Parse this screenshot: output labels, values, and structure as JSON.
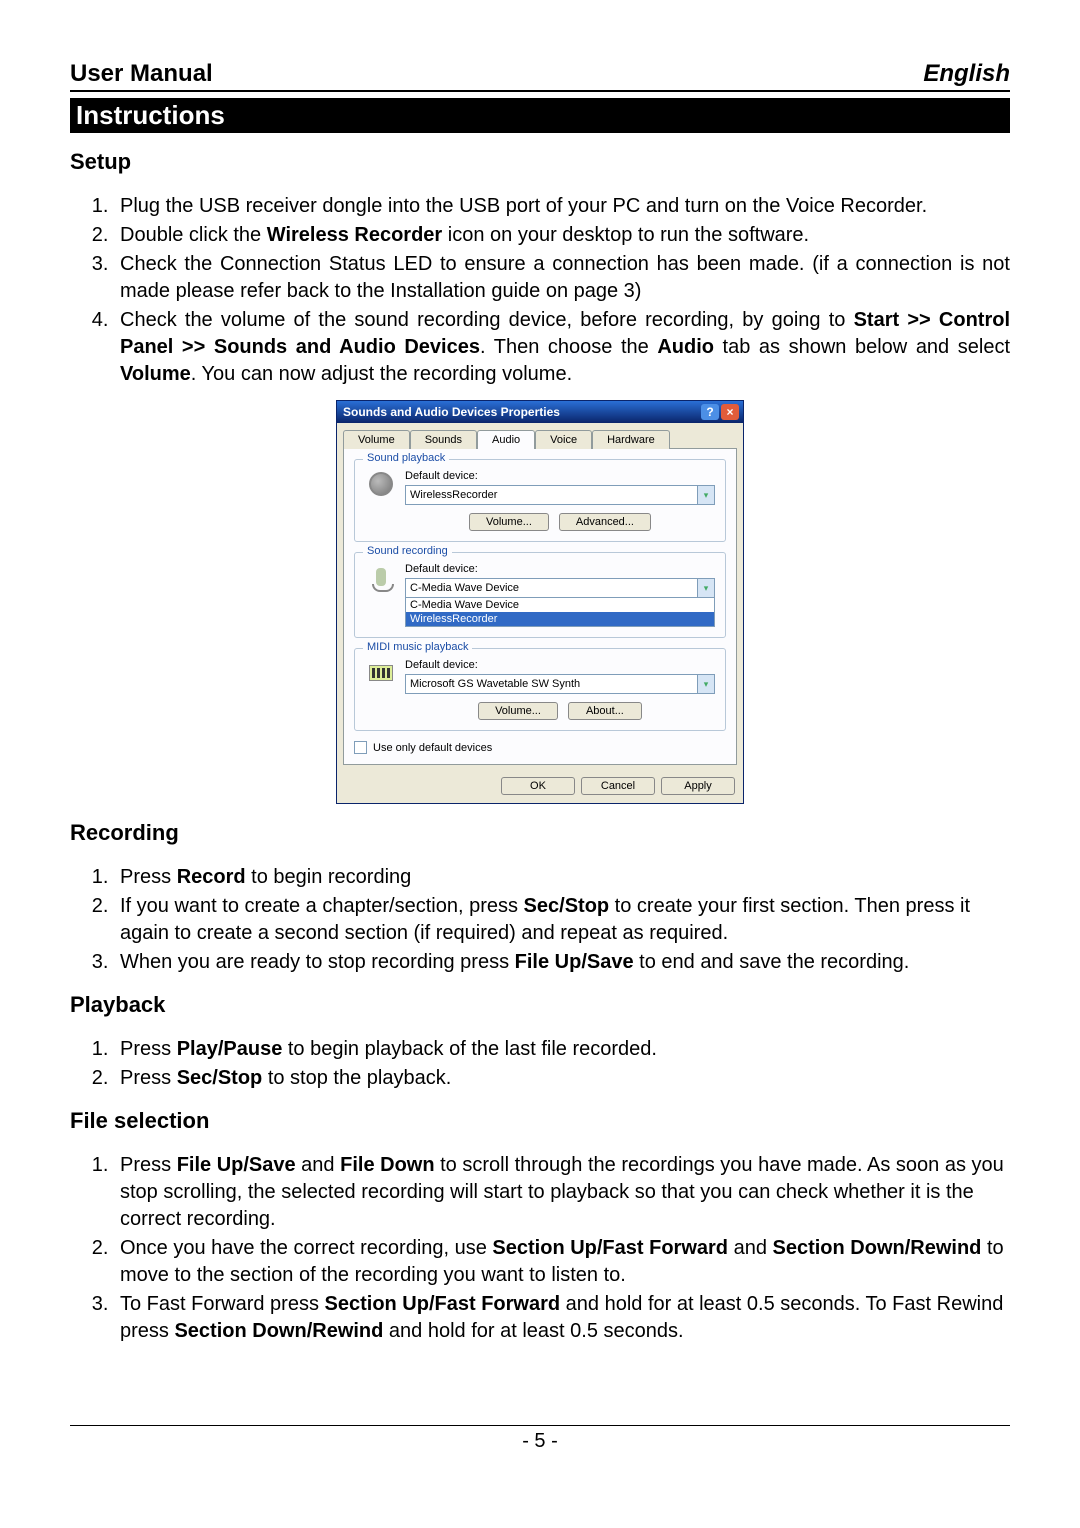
{
  "header": {
    "left": "User Manual",
    "right": "English"
  },
  "banner": "Instructions",
  "setup": {
    "title": "Setup",
    "items": [
      {
        "pre": "Plug the USB receiver dongle into the USB port of your PC and turn on the Voice Recorder."
      },
      {
        "pre": "Double click the ",
        "b1": "Wireless Recorder",
        "post1": " icon on your desktop to run the software."
      },
      {
        "pre": "Check the Connection Status LED to ensure a connection has been made. (if a connection is not made please refer back to the Installation guide on page 3)"
      },
      {
        "pre": "Check the volume of the sound recording device, before recording, by going to ",
        "b1": "Start >> Control Panel >> Sounds and Audio Devices",
        "mid1": ". Then choose the ",
        "b2": "Audio",
        "mid2": " tab as shown below and select ",
        "b3": "Volume",
        "post3": ". You can now adjust the recording volume."
      }
    ]
  },
  "dialog": {
    "title": "Sounds and Audio Devices Properties",
    "tabs": [
      "Volume",
      "Sounds",
      "Audio",
      "Voice",
      "Hardware"
    ],
    "activeTab": "Audio",
    "playback": {
      "legend": "Sound playback",
      "label": "Default device:",
      "value": "WirelessRecorder",
      "btn1": "Volume...",
      "btn2": "Advanced..."
    },
    "recording": {
      "legend": "Sound recording",
      "label": "Default device:",
      "value": "C-Media Wave Device",
      "options": [
        "C-Media Wave Device",
        "WirelessRecorder"
      ]
    },
    "midi": {
      "legend": "MIDI music playback",
      "label": "Default device:",
      "value": "Microsoft GS Wavetable SW Synth",
      "btn1": "Volume...",
      "btn2": "About..."
    },
    "checkbox": "Use only default devices",
    "buttons": {
      "ok": "OK",
      "cancel": "Cancel",
      "apply": "Apply"
    }
  },
  "recording": {
    "title": "Recording",
    "items": [
      {
        "pre": "Press ",
        "b1": "Record",
        "post1": " to begin recording"
      },
      {
        "pre": "If you want to create a chapter/section, press ",
        "b1": "Sec/Stop",
        "post1": " to create your first section. Then press it again to create a second section (if required) and repeat as required."
      },
      {
        "pre": "When you are ready to stop recording press ",
        "b1": "File Up/Save",
        "post1": "  to end and save the recording."
      }
    ]
  },
  "playback": {
    "title": "Playback",
    "items": [
      {
        "pre": "Press ",
        "b1": "Play/Pause",
        "post1": " to begin playback of the last file recorded."
      },
      {
        "pre": "Press ",
        "b1": "Sec/Stop",
        "post1": " to stop the playback."
      }
    ]
  },
  "fileselection": {
    "title": "File selection",
    "items": [
      {
        "pre": "Press ",
        "b1": "File Up/Save",
        "mid1": " and ",
        "b2": "File Down",
        "post2": " to scroll through the recordings you have made. As soon as you stop scrolling, the selected recording will start to playback so that you can check whether it is the correct recording."
      },
      {
        "pre": "Once you have the correct recording, use ",
        "b1": "Section Up/Fast Forward",
        "mid1": " and ",
        "b2": "Section Down/Rewind",
        "post2": " to move to the section of the recording you want to listen to."
      },
      {
        "pre": "To Fast Forward press ",
        "b1": "Section Up/Fast Forward",
        "mid1": " and hold for at least 0.5 seconds. To Fast Rewind press ",
        "b2": "Section Down/Rewind",
        "post2": " and hold for at least 0.5 seconds."
      }
    ]
  },
  "footer": "- 5 -"
}
